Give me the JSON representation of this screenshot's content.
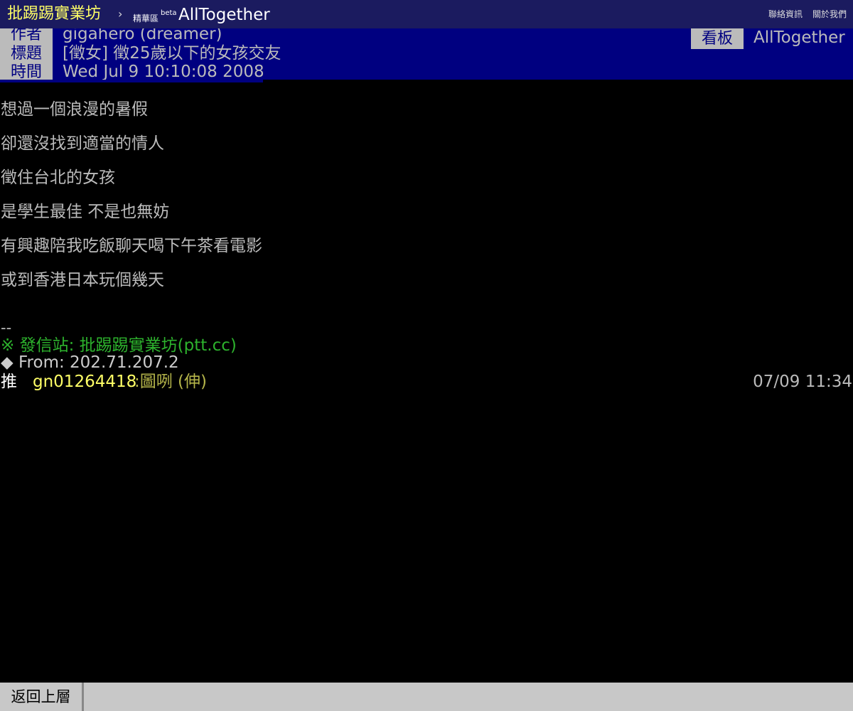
{
  "topbar": {
    "site_name": "批踢踢實業坊",
    "separator": "›",
    "area_label": "精華區",
    "beta_label": "beta",
    "board_name": "AllTogether",
    "links": [
      "聯絡資訊",
      "關於我們"
    ]
  },
  "meta": {
    "author_tag": "作者",
    "author_value": "gigahero (dreamer)",
    "title_tag": "標題",
    "title_value": "[徵女] 徵25歲以下的女孩交友",
    "time_tag": "時間",
    "time_value": "Wed Jul  9 10:10:08 2008",
    "board_tag": "看板",
    "board_value": "AllTogether"
  },
  "body_lines": [
    "想過一個浪漫的暑假",
    "卻還沒找到適當的情人",
    "徵住台北的女孩",
    "是學生最佳 不是也無妨",
    "有興趣陪我吃飯聊天喝下午茶看電影",
    "或到香港日本玩個幾天"
  ],
  "signature": {
    "separator": "--",
    "origin": "※ 發信站: 批踢踢實業坊(ptt.cc)",
    "from": "◆ From: 202.71.207.2"
  },
  "push": {
    "tag": "推",
    "user": "gn01264418",
    "content": ":圖咧 (伸)",
    "time": "07/09 11:34"
  },
  "bottombar": {
    "back_label": "返回上層"
  },
  "colors": {
    "topbar_bg": "#1b1b5f",
    "meta_bg": "#000080",
    "meta_tag_bg": "#bbbbbb",
    "site_name": "#ffff66",
    "origin_green": "#2db22d",
    "push_user_yellow": "#ffff66",
    "push_content": "#b5b54a"
  }
}
